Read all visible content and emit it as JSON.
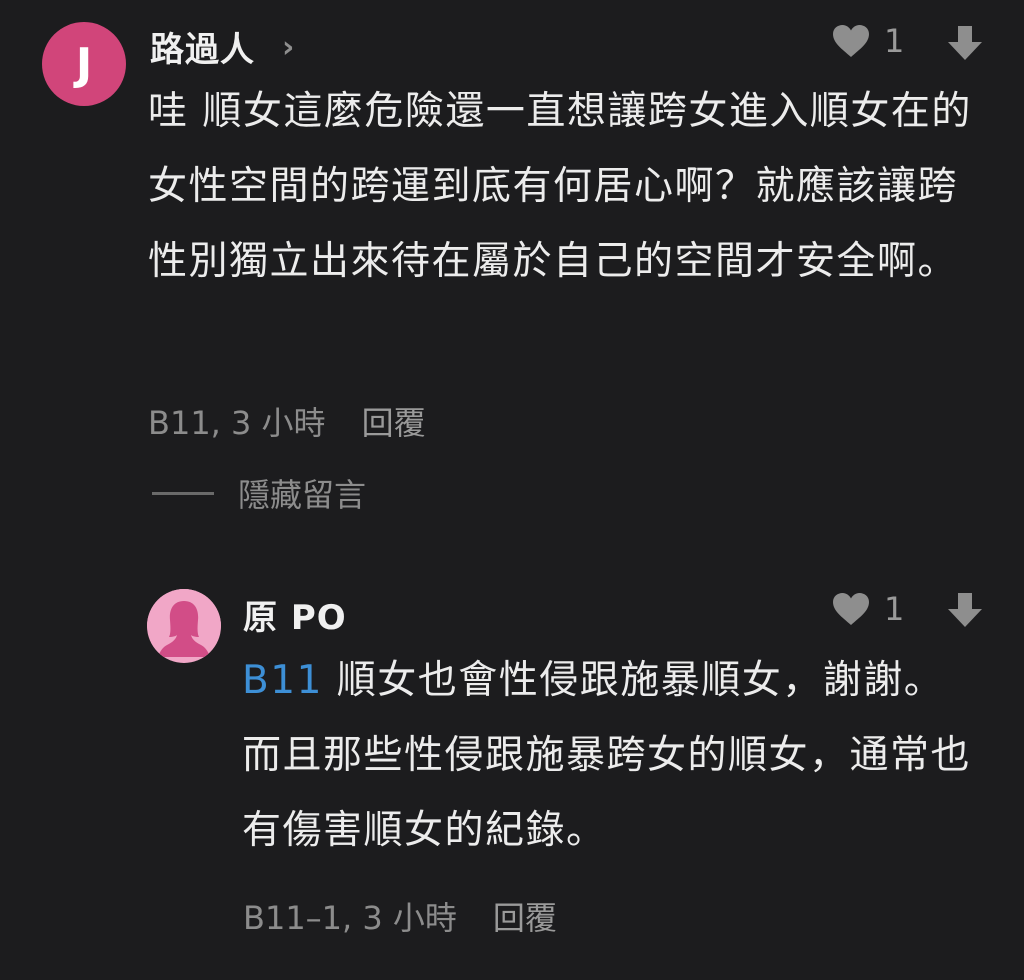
{
  "comment": {
    "avatar_letter": "J",
    "avatar_color": "#d1457a",
    "username": "路過人",
    "likes": "1",
    "body": "哇 順女這麼危險還一直想讓跨女進入順女在的女性空間的跨運到底有何居心啊？就應該讓跨性別獨立出來待在屬於自己的空間才安全啊。",
    "floor_time": "B11, 3 小時",
    "reply_label": "回覆",
    "hide_label": "隱藏留言"
  },
  "reply": {
    "avatar_color": "#f1a7c7",
    "username": "原 PO",
    "likes": "1",
    "mention": "B11",
    "body": " 順女也會性侵跟施暴順女，謝謝。而且那些性侵跟施暴跨女的順女，通常也有傷害順女的紀錄。",
    "floor_time": "B11–1, 3 小時",
    "reply_label": "回覆"
  },
  "colors": {
    "background": "#1c1c1e",
    "mention": "#3d8fd6"
  },
  "icons": [
    "chevron-right-icon",
    "heart-icon",
    "downvote-arrow-icon",
    "person-silhouette-icon"
  ]
}
